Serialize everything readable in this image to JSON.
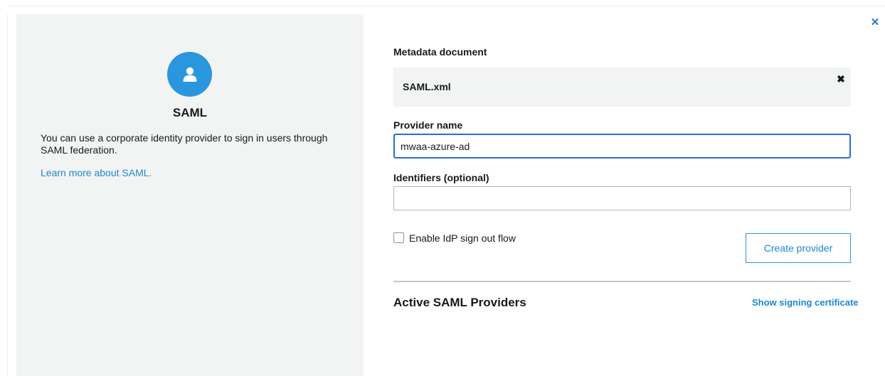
{
  "dialog": {
    "close_icon": "close-icon",
    "accent_color": "#2a96dd"
  },
  "left_panel": {
    "icon": "user-icon",
    "title": "SAML",
    "description": "You can use a corporate identity provider to sign in users through SAML federation.",
    "learn_more_link": "Learn more about SAML."
  },
  "form": {
    "metadata_label": "Metadata document",
    "metadata_file": "SAML.xml",
    "remove_file_icon": "close-icon",
    "provider_name_label": "Provider name",
    "provider_name_value": "mwaa-azure-ad",
    "identifiers_label": "Identifiers (optional)",
    "identifiers_value": "",
    "signout_checkbox_label": "Enable IdP sign out flow",
    "signout_checked": false,
    "create_button": "Create provider"
  },
  "providers": {
    "title": "Active SAML Providers",
    "signing_cert_link": "Show signing certificate"
  }
}
